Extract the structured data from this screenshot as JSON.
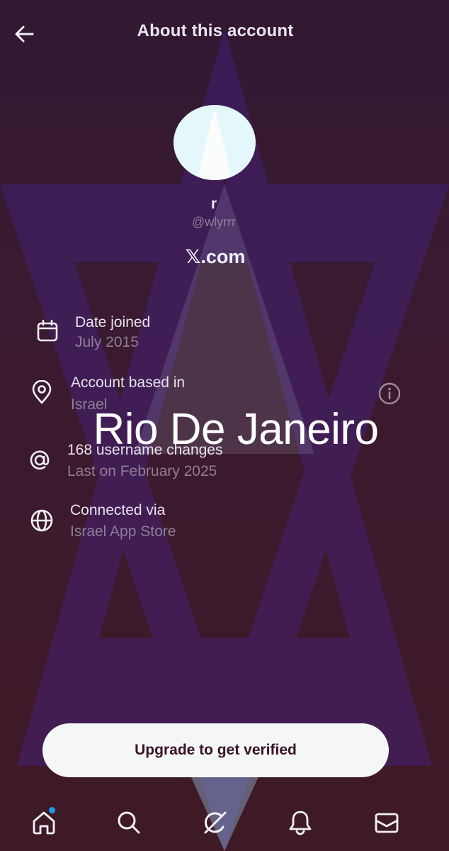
{
  "header": {
    "title": "About this account",
    "back_icon": "arrow-left-icon"
  },
  "profile": {
    "display_name": "r",
    "handle": "@wlyrrr",
    "site": "𝕏.com"
  },
  "info": {
    "date_joined": {
      "label": "Date joined",
      "value": "July 2015",
      "icon": "calendar-icon"
    },
    "based_in": {
      "label": "Account based in",
      "value": "Israel",
      "icon": "location-pin-icon",
      "info_icon": "info-circle-icon"
    },
    "username_changes": {
      "label": "168 username changes",
      "value": "Last on February 2025",
      "icon": "at-sign-icon"
    },
    "connected_via": {
      "label": "Connected via",
      "value": "Israel App Store",
      "icon": "globe-icon"
    }
  },
  "overlay": {
    "text": "Rio De Janeiro"
  },
  "cta": {
    "label": "Upgrade to get verified"
  },
  "bottom_nav": {
    "items": [
      "home-icon",
      "search-icon",
      "grok-icon",
      "bell-icon",
      "mail-icon"
    ]
  },
  "colors": {
    "background": "#3a1a30",
    "watermark": "#452077",
    "text_primary": "#ece8f2",
    "text_secondary": "#8e7e95",
    "button_bg": "#f4f7f5",
    "button_text": "#3a1228",
    "notification_dot": "#1d9bf0"
  }
}
